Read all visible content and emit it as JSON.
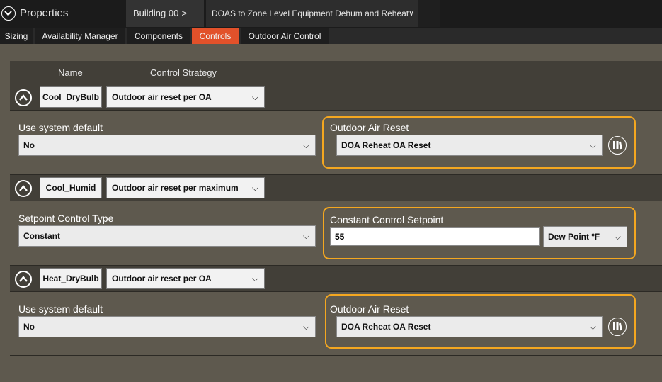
{
  "titlebar": {
    "title": "Properties",
    "breadcrumb": [
      {
        "label": "Building 00",
        "sep": ">"
      },
      {
        "label": "DOAS to Zone Level Equipment Dehum and Reheat",
        "chev": "∨"
      }
    ]
  },
  "tabs": [
    "Sizing",
    "Availability Manager",
    "Components",
    "Controls",
    "Outdoor Air Control"
  ],
  "active_tab": "Controls",
  "columns": {
    "name": "Name",
    "strategy": "Control Strategy"
  },
  "chev": "⌵",
  "groups": [
    {
      "name": "Cool_DryBulb",
      "strategy": "Outdoor air reset per OA",
      "left_label": "Use system default",
      "left_value": "No",
      "right_label": "Outdoor Air Reset",
      "right_value": "DOA Reheat OA Reset"
    },
    {
      "name": "Cool_Humid",
      "strategy": "Outdoor air reset per maximum",
      "left_label": "Setpoint Control Type",
      "left_value": "Constant",
      "right_label": "Constant Control Setpoint",
      "right_value": "55",
      "right_unit": "Dew Point ºF"
    },
    {
      "name": "Heat_DryBulb",
      "strategy": "Outdoor air reset per OA",
      "left_label": "Use system default",
      "left_value": "No",
      "right_label": "Outdoor Air Reset",
      "right_value": "DOA Reheat OA Reset"
    }
  ],
  "colors": {
    "accent": "#e2512a",
    "highlight": "#f4a720",
    "panel": "#5e594e",
    "row": "#423f38"
  }
}
